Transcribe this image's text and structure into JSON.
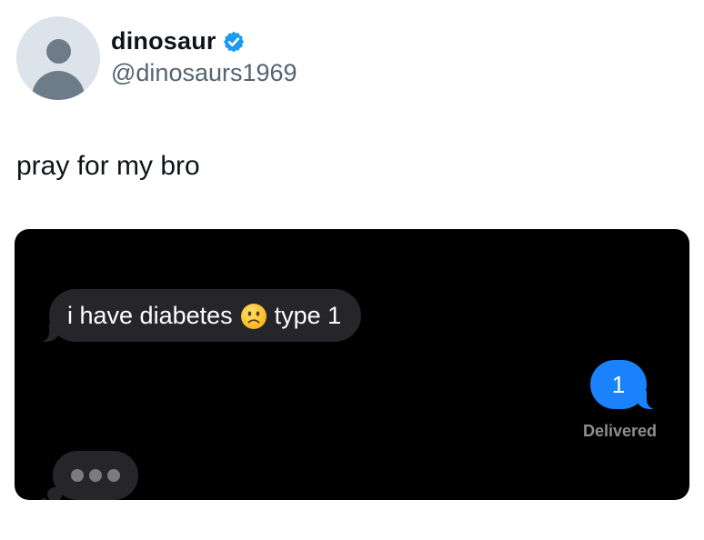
{
  "author": {
    "display_name": "dinosaur",
    "handle": "@dinosaurs1969",
    "verified": true,
    "verified_icon": "verified-badge-icon",
    "avatar_icon": "default-avatar-icon"
  },
  "tweet": {
    "text": "pray for my bro"
  },
  "conversation": {
    "incoming_message": {
      "before_emoji": "i have diabetes",
      "emoji": "slightly-frowning-face-icon",
      "after_emoji": "type 1"
    },
    "outgoing_message": {
      "text": "1"
    },
    "delivery_status": "Delivered",
    "typing_indicator_icon": "typing-dots-icon"
  },
  "colors": {
    "verified_blue": "#1d9bf0",
    "imessage_blue": "#1982fc",
    "incoming_bubble": "#26252a",
    "chat_background": "#000000"
  }
}
